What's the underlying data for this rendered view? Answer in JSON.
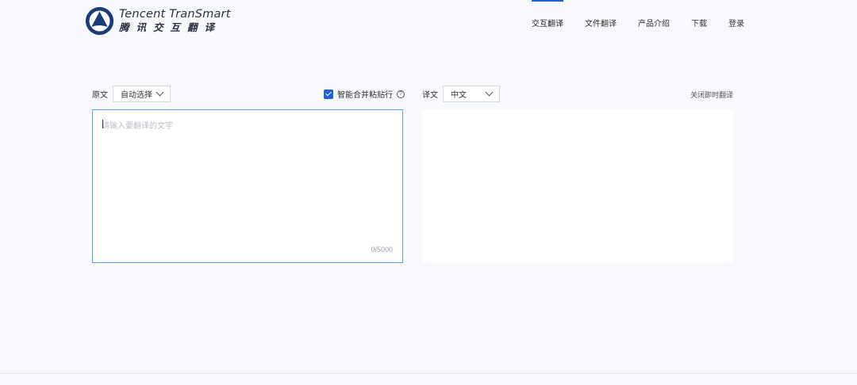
{
  "logo": {
    "title_en": "Tencent TranSmart",
    "title_zh": "腾讯交互翻译"
  },
  "nav": {
    "items": [
      {
        "label": "交互翻译",
        "active": true
      },
      {
        "label": "文件翻译",
        "active": false
      },
      {
        "label": "产品介绍",
        "active": false
      },
      {
        "label": "下载",
        "active": false
      },
      {
        "label": "登录",
        "active": false
      }
    ]
  },
  "source": {
    "label": "原文",
    "language_selected": "自动选择",
    "placeholder": "请输入要翻译的文字",
    "value": "",
    "counter": "0/5000"
  },
  "merge_paste": {
    "label": "智能合并粘贴行",
    "checked": true,
    "help_glyph": "?"
  },
  "target": {
    "label": "译文",
    "language_selected": "中文",
    "instant_toggle_label": "关闭即时翻译",
    "value": ""
  },
  "colors": {
    "accent": "#1f5fd8",
    "input_focus_border": "#5aa0e6",
    "page_background": "#f7f9fc"
  },
  "icons": {
    "logo": "tencent-transmart-logo",
    "select_arrow": "chevron-down-icon",
    "help": "help-circle-icon",
    "checkbox": "checkbox-checked-icon"
  }
}
